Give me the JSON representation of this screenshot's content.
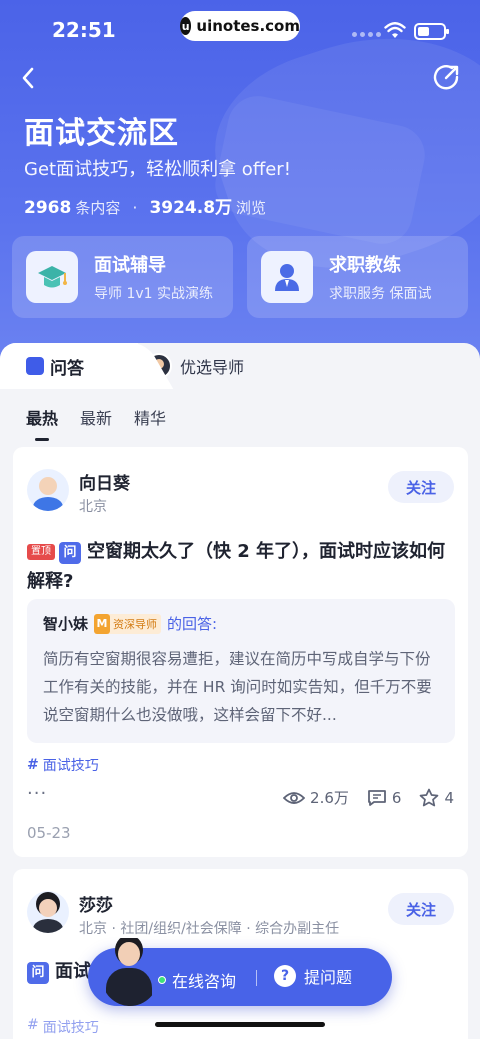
{
  "status_bar": {
    "time": "22:51",
    "site": "uinotes.com"
  },
  "header": {
    "title": "面试交流区",
    "subtitle": "Get面试技巧，轻松顺利拿 offer!",
    "content_count": "2968",
    "content_label": "条内容",
    "separator": "·",
    "view_count": "3924.8万",
    "view_label": "浏览"
  },
  "services": [
    {
      "title": "面试辅导",
      "desc": "导师 1v1 实战演练"
    },
    {
      "title": "求职教练",
      "desc": "求职服务 保面试"
    }
  ],
  "tabs": {
    "qa": "问答",
    "mentors": "优选导师"
  },
  "subtabs": [
    "最热",
    "最新",
    "精华"
  ],
  "posts": [
    {
      "author": "向日葵",
      "location": "北京",
      "follow_label": "关注",
      "pin_label": "置顶",
      "q_badge": "问",
      "question": "空窗期太久了（快 2 年了），面试时应该如何解释?",
      "answerer": "智小妹",
      "mentor_badge_icon": "M",
      "mentor_badge": "资深导师",
      "answer_suffix": "的回答:",
      "answer": "简历有空窗期很容易遭拒，建议在简历中写成自学与下份工作有关的技能，并在 HR 询问时如实告知，但千万不要说空窗期什么也没做哦，这样会留下不好...",
      "tag": "面试技巧",
      "more": "···",
      "views": "2.6万",
      "comments": "6",
      "stars": "4",
      "date": "05-23"
    },
    {
      "author": "莎莎",
      "location": "北京 · 社团/组织/社会保障 · 综合办副主任",
      "follow_label": "关注",
      "q_badge": "问",
      "question": "面试... 不说吗? ...情商...",
      "tag": "面试技巧"
    }
  ],
  "fab": {
    "online": "在线咨询",
    "ask": "提问题",
    "ask_icon": "?"
  },
  "colors": {
    "accent": "#4a62e6",
    "hero": "#4b63e8",
    "pin": "#e64b4b"
  }
}
